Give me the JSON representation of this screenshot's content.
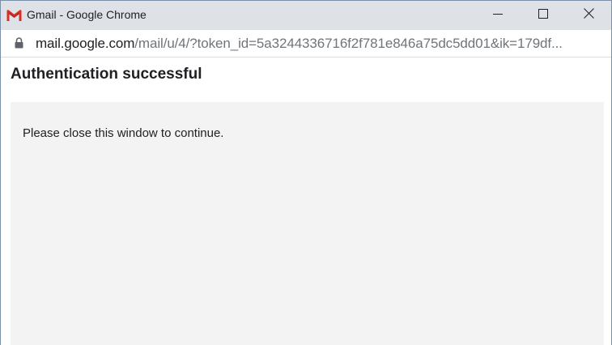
{
  "window": {
    "title": "Gmail - Google Chrome",
    "app_icon": "gmail-icon"
  },
  "controls": {
    "minimize_icon": "minimize-icon",
    "maximize_icon": "maximize-icon",
    "close_icon": "close-icon"
  },
  "address_bar": {
    "security_icon": "lock-icon",
    "host": "mail.google.com",
    "path": "/mail/u/4/?token_id=5a3244336716f2f781e846a75dc5dd01&ik=179df..."
  },
  "page": {
    "heading": "Authentication successful",
    "message": "Please close this window to continue."
  },
  "colors": {
    "titlebar": "#dee1e6",
    "panel": "#f3f3f3",
    "gmail_red": "#d93025"
  }
}
